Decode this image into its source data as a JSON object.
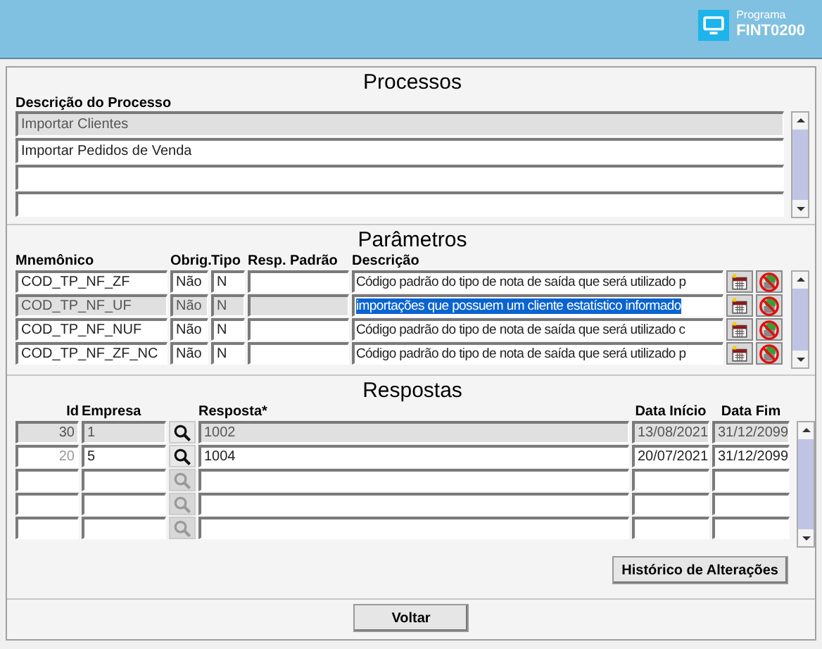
{
  "header": {
    "program_label": "Programa",
    "program_code": "FINT0200"
  },
  "processos": {
    "title": "Processos",
    "column": "Descrição do Processo",
    "rows": [
      {
        "text": "Importar Clientes",
        "selected": true
      },
      {
        "text": "Importar Pedidos de Venda",
        "selected": false
      },
      {
        "selected": false
      },
      {
        "selected": false
      }
    ]
  },
  "parametros": {
    "title": "Parâmetros",
    "columns": [
      "Mnemônico",
      "Obrig.",
      "Tipo",
      "Resp. Padrão",
      "Descrição"
    ],
    "rows": [
      {
        "mnemonico": "COD_TP_NF_ZF",
        "obrig": "Não",
        "tipo": "N",
        "descricao": "Código padrão do tipo de nota de saída que será utilizado p",
        "selected": false
      },
      {
        "mnemonico": "COD_TP_NF_UF",
        "obrig": "Não",
        "tipo": "N",
        "descricao": "importações que possuem um cliente estatístico informado",
        "selected": true
      },
      {
        "mnemonico": "COD_TP_NF_NUF",
        "obrig": "Não",
        "tipo": "N",
        "descricao": "Código padrão do tipo de nota de saída que será utilizado c",
        "selected": false
      },
      {
        "mnemonico": "COD_TP_NF_ZF_NC",
        "obrig": "Não",
        "tipo": "N",
        "descricao": "Código padrão do tipo de nota de saída que será utilizado p",
        "selected": false
      }
    ]
  },
  "respostas": {
    "title": "Respostas",
    "columns": [
      "Id",
      "Empresa",
      "Resposta*",
      "Data Início",
      "Data Fim"
    ],
    "rows": [
      {
        "id": "30",
        "empresa": "1",
        "resposta": "1002",
        "inicio": "13/08/2021",
        "fim": "31/12/2099",
        "selected": true,
        "lookup_enabled": true
      },
      {
        "id": "20",
        "empresa": "5",
        "resposta": "1004",
        "inicio": "20/07/2021",
        "fim": "31/12/2099",
        "selected": false,
        "lookup_enabled": true
      },
      {
        "selected": false,
        "lookup_enabled": false
      },
      {
        "selected": false,
        "lookup_enabled": false
      },
      {
        "selected": false,
        "lookup_enabled": false
      }
    ],
    "history_button": "Histórico de Alterações"
  },
  "footer": {
    "back_button": "Voltar"
  }
}
